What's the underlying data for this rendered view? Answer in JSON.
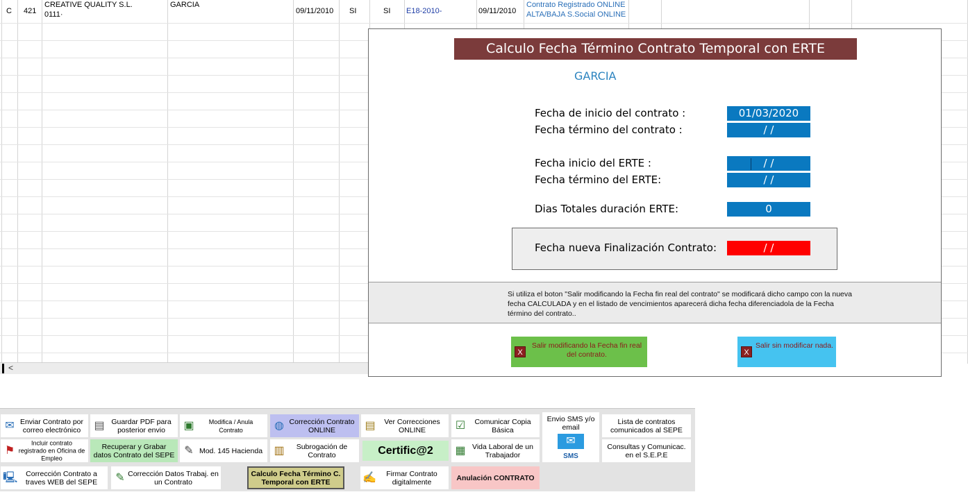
{
  "sheet": {
    "row": {
      "c1": "C",
      "c2": "421",
      "company": "CREATIVE QUALITY S.L.",
      "company_code": "0111·",
      "surname": "GARCIA",
      "date1": "09/11/2010",
      "flag1": "SI",
      "flag2": "SI",
      "contract_ref": "E18-2010-",
      "date2": "09/11/2010",
      "status1": "Contrato Registrado ONLINE",
      "status2": "ALTA/BAJA S.Social ONLINE"
    },
    "scroll_arrow": "<"
  },
  "dialog": {
    "title": "Calculo Fecha Término Contrato Temporal con ERTE",
    "worker_name": "GARCIA",
    "fields": {
      "inicio_contrato_label": "Fecha de inicio del contrato :",
      "inicio_contrato_value": "01/03/2020",
      "termino_contrato_label": "Fecha término del contrato :",
      "termino_contrato_value": "/ /",
      "inicio_erte_label": "Fecha inicio del ERTE :",
      "inicio_erte_value": "/ /",
      "termino_erte_label": "Fecha término del ERTE:",
      "termino_erte_value": "/ /",
      "dias_label": "Dias Totales duración ERTE:",
      "dias_value": "0",
      "nueva_fin_label": "Fecha nueva Finalización Contrato:",
      "nueva_fin_value": "/ /"
    },
    "info_text": "Si utiliza el boton \"Salir modificando la Fecha fin real del contrato\" se modificará  dicho campo con la nueva fecha CALCULADA  y en el listado de vencimientos aparecerá dicha fecha diferenciadola  de la Fecha término del contrato..",
    "btn_salir_modificando": "Salir modificando la Fecha fin real del contrato.",
    "btn_salir_sin": "Salir sin modificar nada.",
    "btn_x": "X"
  },
  "toolbar": {
    "enviar_contrato": "Enviar Contrato por correo electrónico",
    "guardar_pdf": "Guardar PDF para posterior envio",
    "modifica_anula": "Modifica / Anula Contrato",
    "correccion_online": "Corrección Contrato ONLINE",
    "ver_correcciones": "Ver Correcciones ONLINE",
    "comunicar_copia": "Comunicar Copia Básica",
    "envio_sms": "Envio SMS y/o email",
    "sms_label": "SMS",
    "lista_contratos": "Lista de contratos comunicados al SEPE",
    "incluir_contrato": "Incluir contrato registrado en Oficina de Empleo",
    "recuperar_grabar": "Recuperar y Grabar datos Contrato del SEPE",
    "mod145": "Mod. 145 Hacienda",
    "subrogacion": "Subrogación de Contrato",
    "certifica": "Certific@2",
    "vida_laboral": "Vida Laboral de un Trabajador",
    "consultas": "Consultas y Comunicac. en el S.E.P.E",
    "correccion_web": "Corrección Contrato a traves WEB del SEPE",
    "correccion_datos": "Corrección Datos Trabaj. en un Contrato",
    "calculo_erte": "Calculo Fecha Término C. Temporal con ERTE",
    "firmar": "Firmar Contrato digitalmente",
    "anulacion": "Anulación CONTRATO"
  },
  "icons": {
    "envelope": "envelope-icon",
    "pdf": "pdf-save-icon",
    "edit": "edit-contract-icon",
    "globe": "globe-online-icon",
    "document": "document-list-icon",
    "check_doc": "check-document-icon",
    "mail": "mail-sms-icon",
    "signature": "signature-icon"
  },
  "colors": {
    "title_bar": "#7b3b3b",
    "field_blue": "#0a79c0",
    "field_red": "#ff0000",
    "btn_green": "#6cc04a",
    "btn_cyan": "#45c3f0",
    "tb_lavender": "#bdbff0",
    "tb_green": "#b9e8b9",
    "tb_khaki": "#cfcc8b",
    "tb_pink": "#f8c6c6"
  }
}
